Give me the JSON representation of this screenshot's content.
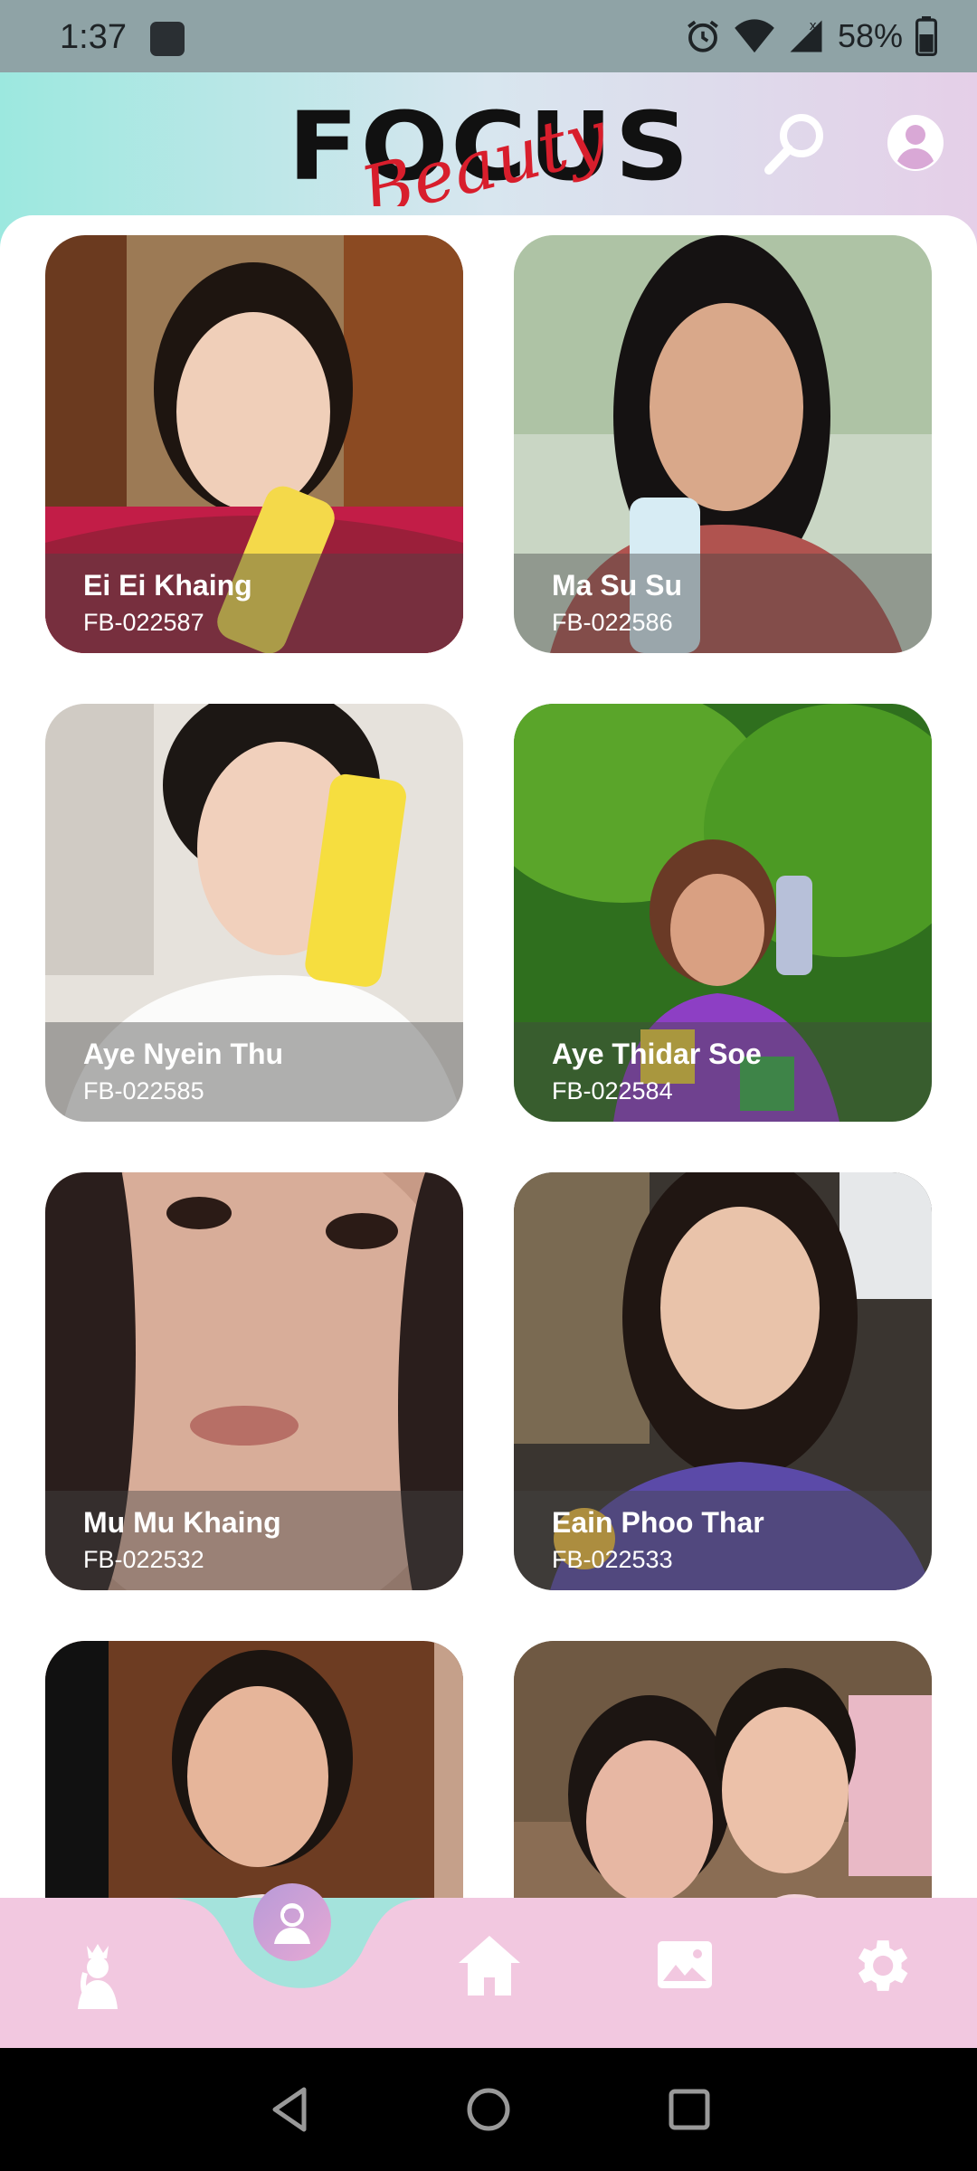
{
  "status_bar": {
    "time": "1:37",
    "battery": "58%",
    "icons": [
      "notification-icon",
      "alarm-icon",
      "wifi-icon",
      "signal-icon",
      "battery-icon"
    ]
  },
  "header": {
    "logo_main": "FOCUS",
    "logo_script": "Beauty",
    "icons": [
      "search-icon",
      "account-icon"
    ],
    "colors": {
      "gradient_left": "#9ce8df",
      "gradient_right": "#e5cfe8",
      "logo_red": "#d81e2c"
    }
  },
  "profiles": [
    {
      "name": "Ei Ei Khaing",
      "code": "FB-022587"
    },
    {
      "name": "Ma Su Su",
      "code": "FB-022586"
    },
    {
      "name": "Aye Nyein Thu",
      "code": "FB-022585"
    },
    {
      "name": "Aye Thidar Soe",
      "code": "FB-022584"
    },
    {
      "name": "Mu Mu Khaing",
      "code": "FB-022532"
    },
    {
      "name": "Eain Phoo Thar",
      "code": "FB-022533"
    },
    {
      "name": "",
      "code": ""
    },
    {
      "name": "",
      "code": ""
    }
  ],
  "bottom_nav": {
    "items": [
      "princess-icon",
      "profile-icon",
      "home-icon",
      "gallery-icon",
      "settings-icon"
    ],
    "active": "profile-icon",
    "colors": {
      "background": "#f2c8e0",
      "accent": "#a4e3dc"
    }
  },
  "system_nav": {
    "icons": [
      "back-icon",
      "home-circle-icon",
      "recents-icon"
    ]
  }
}
